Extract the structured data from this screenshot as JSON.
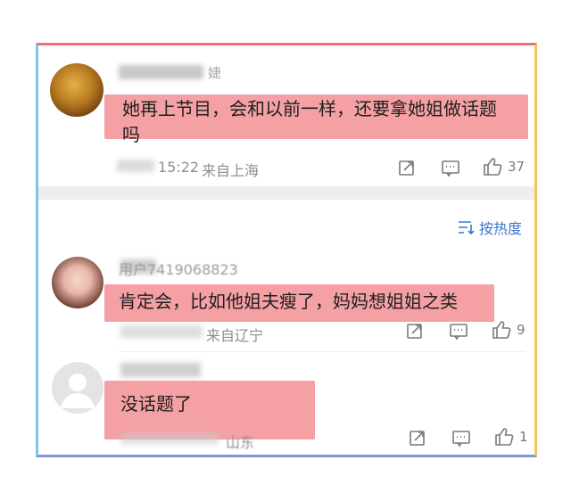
{
  "comments": [
    {
      "user_visible": "婕",
      "text": "她再上节目，会和以前一样，还要拿她姐做话题\n吗",
      "time": "15:22",
      "location": "来自上海",
      "likes": "37"
    },
    {
      "user_visible": "用户7419068823",
      "text": "肯定会，比如他姐夫瘦了，妈妈想姐姐之类",
      "location": "来自辽宁",
      "likes": "9"
    },
    {
      "user_visible": "",
      "text": "没话题了",
      "location": "山东",
      "likes": "1"
    }
  ],
  "sort_label": "按热度",
  "icons": [
    "repost-icon",
    "comment-icon",
    "like-icon",
    "sort-icon"
  ],
  "colors": {
    "highlight": "#f5a0a4",
    "accent": "#3a78c9",
    "meta": "#8e8e8e"
  }
}
